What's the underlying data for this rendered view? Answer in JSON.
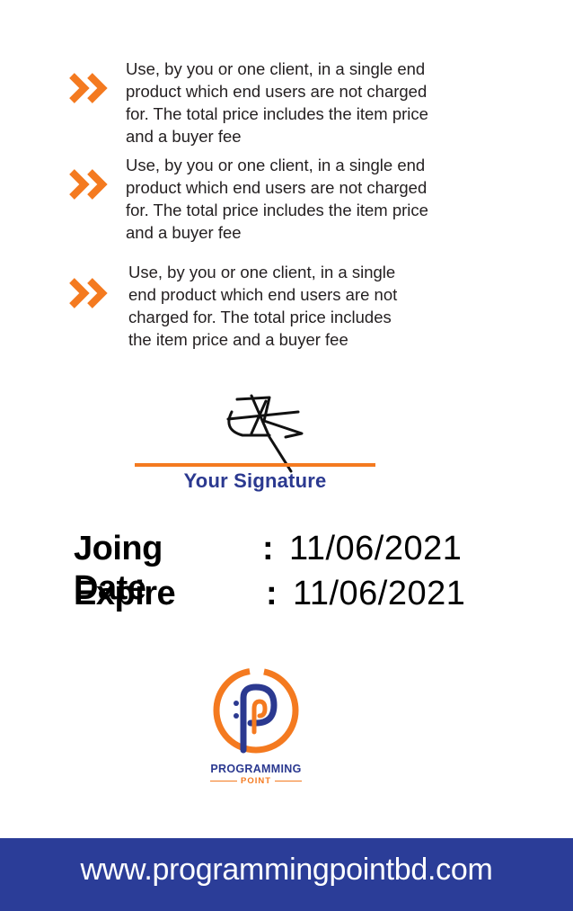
{
  "terms": [
    {
      "text": "Use, by you or one client, in a single end\nproduct which end users are not charged\nfor. The total price includes the item price\nand a buyer fee",
      "icon": "double-chevron-right-icon"
    },
    {
      "text": "Use, by you or one client, in a single end\nproduct which end users are not charged\nfor. The total price includes the item price\nand a buyer fee",
      "icon": "double-chevron-right-icon"
    },
    {
      "text": "Use, by you or one client, in a single\nend product which end users are not\ncharged for. The total price includes\nthe item price and a buyer fee",
      "icon": "double-chevron-right-icon"
    }
  ],
  "signature": {
    "caption": "Your Signature"
  },
  "dates": {
    "joining": {
      "label": "Joing Date",
      "colon": ":",
      "value": "11/06/2021"
    },
    "expire": {
      "label": "Expire",
      "colon": ":",
      "value": "11/06/2021"
    }
  },
  "logo": {
    "line1": "PROGRAMMING",
    "line2": "POINT"
  },
  "footer": {
    "url": "www.programmingpointbd.com"
  },
  "colors": {
    "accent": "#f47a20",
    "brand": "#2b3990",
    "footer_bg": "#2b3d98"
  }
}
